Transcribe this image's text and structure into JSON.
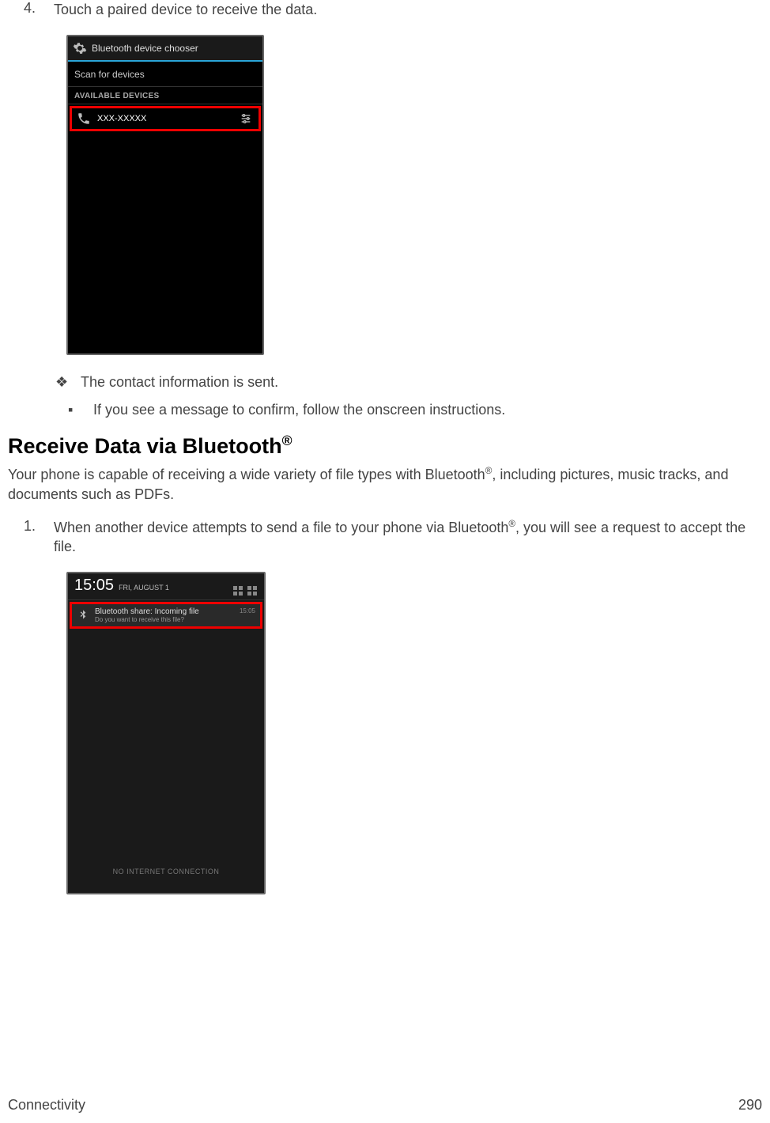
{
  "step4": {
    "num": "4.",
    "text": "Touch a paired device to receive the data."
  },
  "screenshot1": {
    "title": "Bluetooth device chooser",
    "scan": "Scan for devices",
    "section": "AVAILABLE DEVICES",
    "device": "XXX-XXXXX"
  },
  "note1": {
    "bullet": "❖",
    "text": "The contact information is sent."
  },
  "note2": {
    "bullet": "▪",
    "text": "If you see a message to confirm, follow the onscreen instructions."
  },
  "heading": {
    "title": "Receive Data via Bluetooth",
    "sup": "®"
  },
  "intro": {
    "pre": "Your phone is capable of receiving a wide variety of file types with Bluetooth",
    "sup": "®",
    "post": ", including pictures, music tracks, and documents such as PDFs."
  },
  "step1": {
    "num": "1.",
    "pre": "When another device attempts to send a file to your phone via Bluetooth",
    "sup": "®",
    "post": ", you will see a request to accept the file."
  },
  "screenshot2": {
    "time": "15:05",
    "date": "FRI, AUGUST 1",
    "notif_title": "Bluetooth share: Incoming file",
    "notif_sub": "Do you want to receive this file?",
    "notif_time": "15:05",
    "no_conn": "NO INTERNET CONNECTION"
  },
  "footer": {
    "section": "Connectivity",
    "page": "290"
  }
}
